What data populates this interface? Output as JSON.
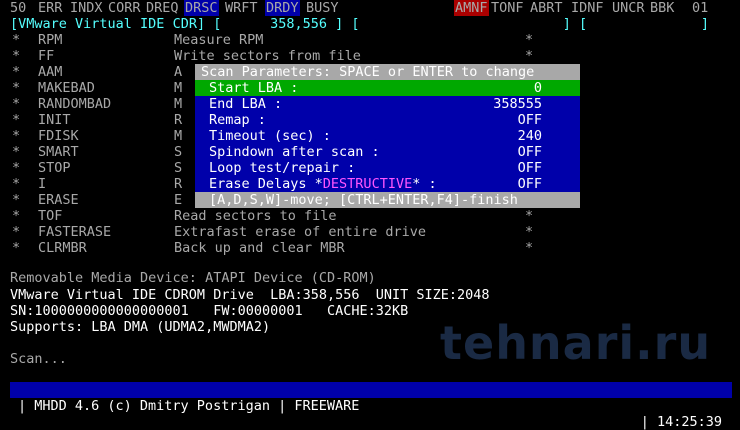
{
  "register_bar": {
    "items": [
      {
        "label": "50",
        "style": "normal"
      },
      {
        "label": "ERR",
        "style": "normal"
      },
      {
        "label": "INDX",
        "style": "normal"
      },
      {
        "label": "CORR",
        "style": "normal"
      },
      {
        "label": "DREQ",
        "style": "normal"
      },
      {
        "label": "DRSC",
        "style": "highlight"
      },
      {
        "label": "WRFT",
        "style": "normal"
      },
      {
        "label": "DRDY",
        "style": "highlight"
      },
      {
        "label": "BUSY",
        "style": "normal"
      },
      {
        "label": "AMNF",
        "style": "alert"
      },
      {
        "label": "TONF",
        "style": "normal"
      },
      {
        "label": "ABRT",
        "style": "normal"
      },
      {
        "label": "IDNF",
        "style": "normal"
      },
      {
        "label": "UNCR",
        "style": "normal"
      },
      {
        "label": "BBK",
        "style": "normal"
      },
      {
        "label": "01",
        "style": "normal"
      }
    ]
  },
  "device_bar": {
    "device": "VMware Virtual IDE CDR",
    "lba": "358,556"
  },
  "commands": [
    {
      "name": "RPM",
      "desc": "Measure RPM"
    },
    {
      "name": "FF",
      "desc": "Write sectors from file"
    },
    {
      "name": "AAM",
      "desc": "A"
    },
    {
      "name": "MAKEBAD",
      "desc": "M"
    },
    {
      "name": "RANDOMBAD",
      "desc": "M"
    },
    {
      "name": "INIT",
      "desc": "R"
    },
    {
      "name": "FDISK",
      "desc": "M"
    },
    {
      "name": "SMART",
      "desc": "S"
    },
    {
      "name": "STOP",
      "desc": "S"
    },
    {
      "name": "I",
      "desc": "R"
    },
    {
      "name": "ERASE",
      "desc": "E"
    },
    {
      "name": "TOF",
      "desc": "Read sectors to file"
    },
    {
      "name": "FASTERASE",
      "desc": "Extrafast erase of entire drive"
    },
    {
      "name": "CLRMBR",
      "desc": "Back up and clear MBR"
    }
  ],
  "dialog": {
    "title": "Scan Parameters: SPACE or ENTER to change",
    "rows": [
      {
        "label": "Start LBA :",
        "value": "0"
      },
      {
        "label": "End LBA :",
        "value": "358555"
      },
      {
        "label": "Remap :",
        "value": "OFF"
      },
      {
        "label": "Timeout (sec) :",
        "value": "240"
      },
      {
        "label": "Spindown after scan :",
        "value": "OFF"
      },
      {
        "label": "Loop test/repair :",
        "value": "OFF"
      }
    ],
    "erase_row": {
      "prefix": "Erase Delays *",
      "destructive": "DESTRUCTIVE",
      "suffix": "* :",
      "value": "OFF"
    },
    "footer": "[A,D,S,W]-move; [CTRL+ENTER,F4]-finish"
  },
  "info": {
    "line1": "Removable Media Device: ATAPI Device (CD-ROM)",
    "line2": "VMware Virtual IDE CDROM Drive  LBA:358,556  UNIT SIZE:2048",
    "line3": "SN:1000000000000000001   FW:00000001   CACHE:32KB",
    "line4": "Supports: LBA DMA (UDMA2,MWDMA2)"
  },
  "scan_text": "Scan...",
  "status_bar": {
    "left": "| MHDD 4.6 (c) Dmitry Postrigan | FREEWARE",
    "right": "| 14:25:39"
  },
  "watermark": "tehnari.ru"
}
